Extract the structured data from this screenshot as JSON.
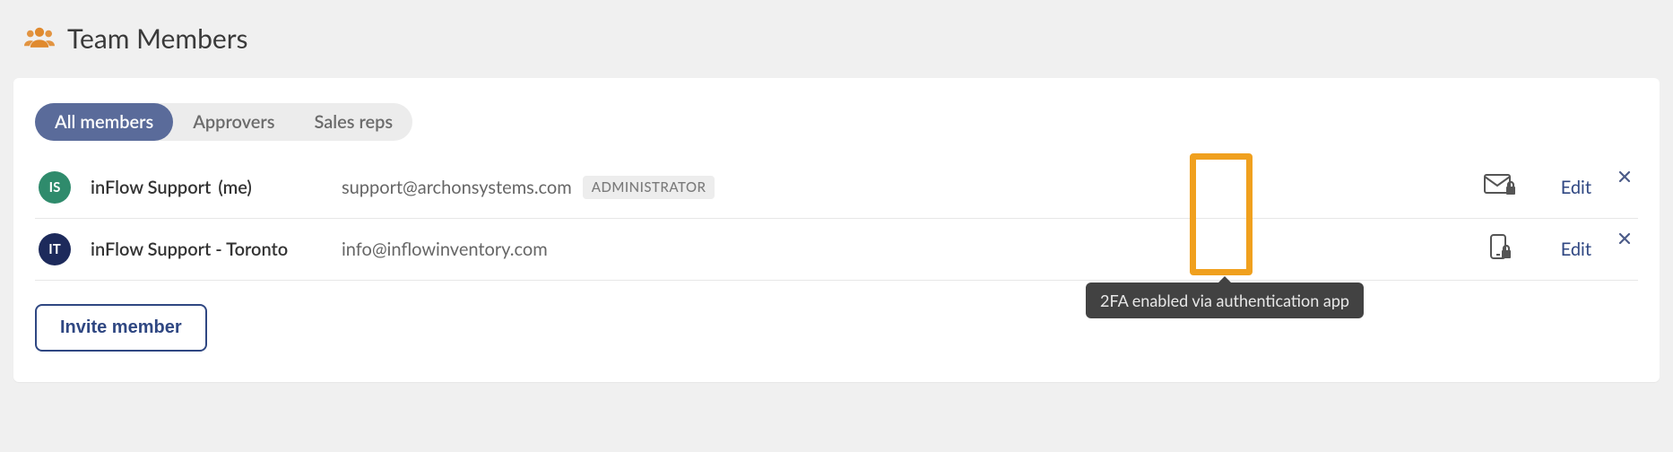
{
  "header": {
    "title": "Team Members"
  },
  "tabs": [
    {
      "label": "All members",
      "active": true
    },
    {
      "label": "Approvers",
      "active": false
    },
    {
      "label": "Sales reps",
      "active": false
    }
  ],
  "members": [
    {
      "initials": "IS",
      "avatar_color": "#2f8b6c",
      "name": "inFlow Support",
      "me_suffix": "(me)",
      "email": "support@archonsystems.com",
      "role_badge": "ADMINISTRATOR",
      "mfa_type": "email",
      "edit_label": "Edit"
    },
    {
      "initials": "IT",
      "avatar_color": "#1d2a5b",
      "name": "inFlow Support - Toronto",
      "me_suffix": "",
      "email": "info@inflowinventory.com",
      "role_badge": "",
      "mfa_type": "app",
      "edit_label": "Edit"
    }
  ],
  "tooltip_text": "2FA enabled via authentication app",
  "invite_label": "Invite member"
}
